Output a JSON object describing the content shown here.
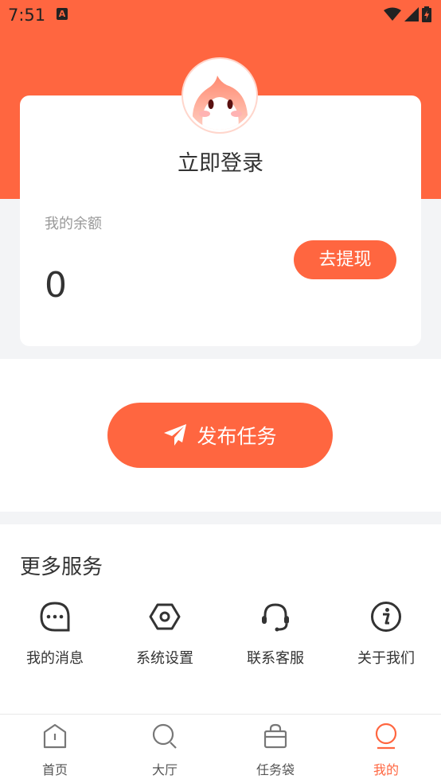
{
  "status_bar": {
    "time": "7:51",
    "app_icon_letter": "A"
  },
  "profile": {
    "login_label": "立即登录"
  },
  "balance": {
    "label": "我的余额",
    "value": "0",
    "withdraw_label": "去提现"
  },
  "publish": {
    "label": "发布任务"
  },
  "services": {
    "title": "更多服务",
    "items": [
      {
        "label": "我的消息",
        "icon": "message-icon"
      },
      {
        "label": "系统设置",
        "icon": "settings-icon"
      },
      {
        "label": "联系客服",
        "icon": "headset-icon"
      },
      {
        "label": "关于我们",
        "icon": "info-icon"
      }
    ]
  },
  "tabbar": {
    "items": [
      {
        "label": "首页",
        "icon": "home-icon",
        "active": false
      },
      {
        "label": "大厅",
        "icon": "search-icon",
        "active": false
      },
      {
        "label": "任务袋",
        "icon": "bag-icon",
        "active": false
      },
      {
        "label": "我的",
        "icon": "profile-icon",
        "active": true
      }
    ]
  },
  "colors": {
    "accent": "#ff6640",
    "background": "#f3f4f6"
  }
}
